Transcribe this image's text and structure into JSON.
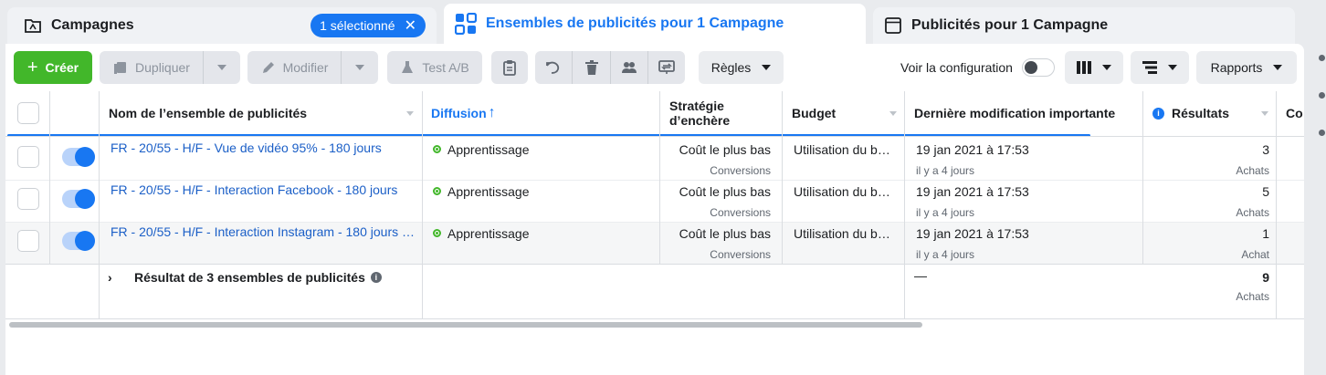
{
  "tabs": {
    "campaigns": {
      "label": "Campagnes",
      "selected_pill": "1 sélectionné"
    },
    "adsets": {
      "label": "Ensembles de publicités pour 1 Campagne"
    },
    "ads": {
      "label": "Publicités pour 1 Campagne"
    }
  },
  "toolbar": {
    "create": "Créer",
    "duplicate": "Dupliquer",
    "edit": "Modifier",
    "ab_test": "Test A/B",
    "rules": "Règles",
    "view_config": "Voir la configuration",
    "reports": "Rapports",
    "icons": [
      "duplicate-icon",
      "pencil-icon",
      "flask-icon",
      "clipboard-icon",
      "undo-icon",
      "trash-icon",
      "people-icon",
      "swap-icon",
      "columns-icon",
      "breakdown-icon"
    ]
  },
  "table": {
    "headers": {
      "name": "Nom de l’ensemble de publicités",
      "delivery": "Diffusion",
      "delivery_arrow": "↑",
      "bid_strategy_1": "Stratégie",
      "bid_strategy_2": "d’enchère",
      "budget": "Budget",
      "last_edit": "Dernière modification importante",
      "results": "Résultats",
      "cut_column": "Co"
    },
    "rows": [
      {
        "name": "FR - 20/55 - H/F - Vue de vidéo 95% - 180 jours",
        "delivery": "Apprentissage",
        "bid": "Coût le plus bas",
        "bid_sub": "Conversions",
        "budget": "Utilisation du b…",
        "edit_date": "19 jan 2021 à 17:53",
        "edit_ago": "il y a 4 jours",
        "results": "3",
        "results_sub": "Achats"
      },
      {
        "name": "FR - 20/55 - H/F - Interaction Facebook - 180 jours",
        "delivery": "Apprentissage",
        "bid": "Coût le plus bas",
        "bid_sub": "Conversions",
        "budget": "Utilisation du b…",
        "edit_date": "19 jan 2021 à 17:53",
        "edit_ago": "il y a 4 jours",
        "results": "5",
        "results_sub": "Achats"
      },
      {
        "name": "FR - 20/55 - H/F - Interaction Instagram - 180 jours …",
        "delivery": "Apprentissage",
        "bid": "Coût le plus bas",
        "bid_sub": "Conversions",
        "budget": "Utilisation du b…",
        "edit_date": "19 jan 2021 à 17:53",
        "edit_ago": "il y a 4 jours",
        "results": "1",
        "results_sub": "Achat"
      }
    ],
    "summary": {
      "label": "Résultat de 3 ensembles de publicités",
      "last_edit": "—",
      "results": "9",
      "results_sub": "Achats"
    }
  },
  "colors": {
    "accent": "#1877f2",
    "create": "#42b72a",
    "link": "#1b5fc7"
  }
}
